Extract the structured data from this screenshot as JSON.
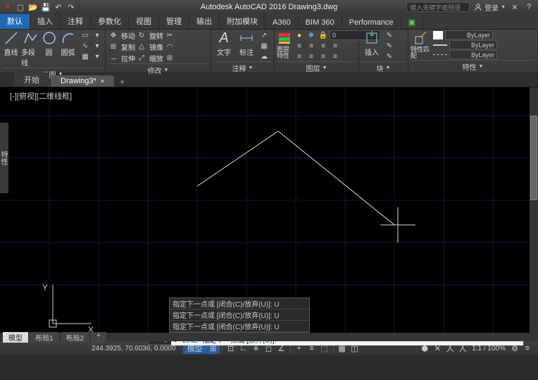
{
  "titlebar": {
    "app_title": "Autodesk AutoCAD 2016   Drawing3.dwg",
    "search_placeholder": "键入关键字或短语",
    "login_label": "登录"
  },
  "menubar": {
    "tabs": [
      "默认",
      "插入",
      "注释",
      "参数化",
      "视图",
      "管理",
      "输出",
      "附加模块",
      "A360",
      "BIM 360",
      "Performance"
    ]
  },
  "ribbon": {
    "panels": {
      "draw": {
        "title": "绘图",
        "tools": [
          "直线",
          "多段线",
          "圆",
          "圆弧"
        ]
      },
      "modify": {
        "title": "修改",
        "rows": [
          [
            "移动",
            "旋转"
          ],
          [
            "复制",
            "镜像"
          ],
          [
            "拉伸",
            "缩放"
          ]
        ]
      },
      "annotate": {
        "title": "注释",
        "tools": [
          "文字",
          "标注"
        ]
      },
      "layers": {
        "title": "图层",
        "tool": "图层特性",
        "current": "0"
      },
      "block": {
        "title": "块",
        "tool": "插入"
      },
      "props": {
        "title": "特性",
        "tool": "特性匹配",
        "bylayer": "ByLayer"
      }
    }
  },
  "filetabs": {
    "start": "开始",
    "active": "Drawing3*"
  },
  "workspace": {
    "view_label": "[-][俯视][二维线框]",
    "axis_y": "Y",
    "axis_x": "X",
    "sheets": [
      "模型",
      "布局1",
      "布局2"
    ]
  },
  "sideprops": "特性",
  "command": {
    "history": [
      "指定下一点或 [闭合(C)/放弃(U)]: U",
      "指定下一点或 [闭合(C)/放弃(U)]: U",
      "指定下一点或 [闭合(C)/放弃(U)]: U"
    ],
    "cmd_name": "LINE",
    "prompt_text": "指定下一点或 [",
    "prompt_opt": "放弃(U)",
    "prompt_tail": "]:"
  },
  "statusbar": {
    "coords": "244.3925, 70.6036, 0.0000",
    "model": "模型",
    "scale": "1:1 / 100%"
  }
}
